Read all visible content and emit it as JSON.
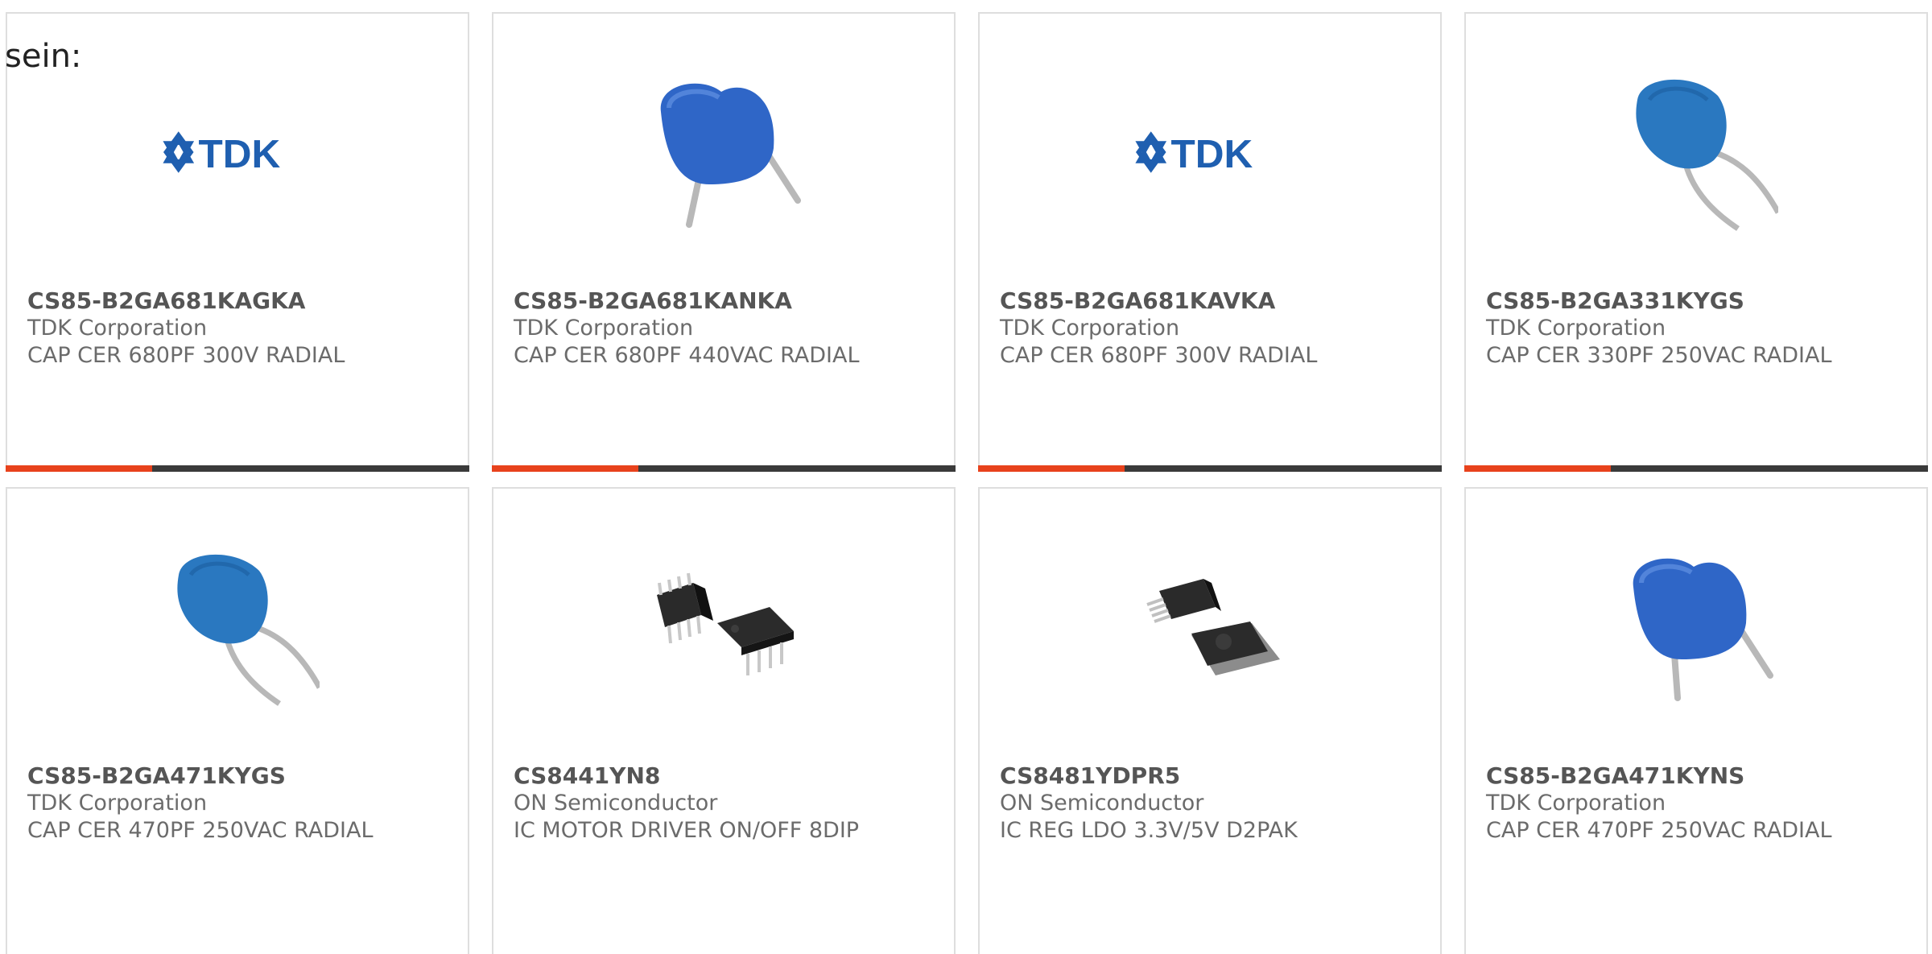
{
  "intro_text": "sein:",
  "colors": {
    "accent_bar": "#e8421c",
    "dark_bar": "#3a3a3a",
    "border": "#dedede",
    "tdk_blue": "#1f5fb0",
    "cap_blue": "#2f66c7"
  },
  "products": [
    {
      "part": "CS85-B2GA681KAGKA",
      "manufacturer": "TDK Corporation",
      "description": "CAP CER 680PF 300V RADIAL",
      "image": "tdk-logo",
      "logo_text": "TDK"
    },
    {
      "part": "CS85-B2GA681KANKA",
      "manufacturer": "TDK Corporation",
      "description": "CAP CER 680PF 440VAC RADIAL",
      "image": "ceramic-capacitor-blue"
    },
    {
      "part": "CS85-B2GA681KAVKA",
      "manufacturer": "TDK Corporation",
      "description": "CAP CER 680PF 300V RADIAL",
      "image": "tdk-logo",
      "logo_text": "TDK"
    },
    {
      "part": "CS85-B2GA331KYGS",
      "manufacturer": "TDK Corporation",
      "description": "CAP CER 330PF 250VAC RADIAL",
      "image": "ceramic-capacitor-teal"
    },
    {
      "part": "CS85-B2GA471KYGS",
      "manufacturer": "TDK Corporation",
      "description": "CAP CER 470PF 250VAC RADIAL",
      "image": "ceramic-capacitor-teal"
    },
    {
      "part": "CS8441YN8",
      "manufacturer": "ON Semiconductor",
      "description": "IC MOTOR DRIVER ON/OFF 8DIP",
      "image": "dip8-ic"
    },
    {
      "part": "CS8481YDPR5",
      "manufacturer": "ON Semiconductor",
      "description": "IC REG LDO 3.3V/5V D2PAK",
      "image": "d2pak-ic"
    },
    {
      "part": "CS85-B2GA471KYNS",
      "manufacturer": "TDK Corporation",
      "description": "CAP CER 470PF 250VAC RADIAL",
      "image": "ceramic-capacitor-blue"
    }
  ]
}
